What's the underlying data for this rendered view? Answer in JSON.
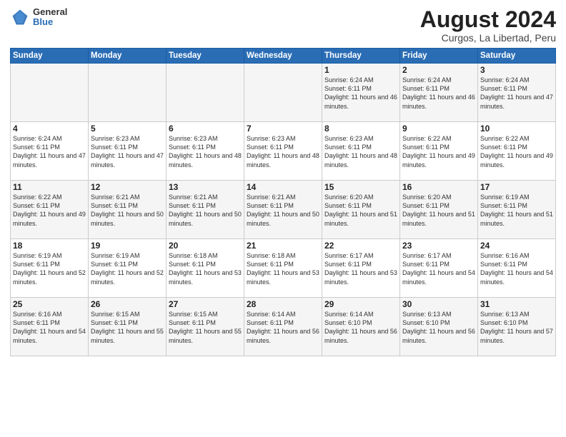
{
  "header": {
    "logo_general": "General",
    "logo_blue": "Blue",
    "title": "August 2024",
    "subtitle": "Curgos, La Libertad, Peru"
  },
  "weekdays": [
    "Sunday",
    "Monday",
    "Tuesday",
    "Wednesday",
    "Thursday",
    "Friday",
    "Saturday"
  ],
  "weeks": [
    [
      {
        "day": "",
        "sunrise": "",
        "sunset": "",
        "daylight": ""
      },
      {
        "day": "",
        "sunrise": "",
        "sunset": "",
        "daylight": ""
      },
      {
        "day": "",
        "sunrise": "",
        "sunset": "",
        "daylight": ""
      },
      {
        "day": "",
        "sunrise": "",
        "sunset": "",
        "daylight": ""
      },
      {
        "day": "1",
        "sunrise": "Sunrise: 6:24 AM",
        "sunset": "Sunset: 6:11 PM",
        "daylight": "Daylight: 11 hours and 46 minutes."
      },
      {
        "day": "2",
        "sunrise": "Sunrise: 6:24 AM",
        "sunset": "Sunset: 6:11 PM",
        "daylight": "Daylight: 11 hours and 46 minutes."
      },
      {
        "day": "3",
        "sunrise": "Sunrise: 6:24 AM",
        "sunset": "Sunset: 6:11 PM",
        "daylight": "Daylight: 11 hours and 47 minutes."
      }
    ],
    [
      {
        "day": "4",
        "sunrise": "Sunrise: 6:24 AM",
        "sunset": "Sunset: 6:11 PM",
        "daylight": "Daylight: 11 hours and 47 minutes."
      },
      {
        "day": "5",
        "sunrise": "Sunrise: 6:23 AM",
        "sunset": "Sunset: 6:11 PM",
        "daylight": "Daylight: 11 hours and 47 minutes."
      },
      {
        "day": "6",
        "sunrise": "Sunrise: 6:23 AM",
        "sunset": "Sunset: 6:11 PM",
        "daylight": "Daylight: 11 hours and 48 minutes."
      },
      {
        "day": "7",
        "sunrise": "Sunrise: 6:23 AM",
        "sunset": "Sunset: 6:11 PM",
        "daylight": "Daylight: 11 hours and 48 minutes."
      },
      {
        "day": "8",
        "sunrise": "Sunrise: 6:23 AM",
        "sunset": "Sunset: 6:11 PM",
        "daylight": "Daylight: 11 hours and 48 minutes."
      },
      {
        "day": "9",
        "sunrise": "Sunrise: 6:22 AM",
        "sunset": "Sunset: 6:11 PM",
        "daylight": "Daylight: 11 hours and 49 minutes."
      },
      {
        "day": "10",
        "sunrise": "Sunrise: 6:22 AM",
        "sunset": "Sunset: 6:11 PM",
        "daylight": "Daylight: 11 hours and 49 minutes."
      }
    ],
    [
      {
        "day": "11",
        "sunrise": "Sunrise: 6:22 AM",
        "sunset": "Sunset: 6:11 PM",
        "daylight": "Daylight: 11 hours and 49 minutes."
      },
      {
        "day": "12",
        "sunrise": "Sunrise: 6:21 AM",
        "sunset": "Sunset: 6:11 PM",
        "daylight": "Daylight: 11 hours and 50 minutes."
      },
      {
        "day": "13",
        "sunrise": "Sunrise: 6:21 AM",
        "sunset": "Sunset: 6:11 PM",
        "daylight": "Daylight: 11 hours and 50 minutes."
      },
      {
        "day": "14",
        "sunrise": "Sunrise: 6:21 AM",
        "sunset": "Sunset: 6:11 PM",
        "daylight": "Daylight: 11 hours and 50 minutes."
      },
      {
        "day": "15",
        "sunrise": "Sunrise: 6:20 AM",
        "sunset": "Sunset: 6:11 PM",
        "daylight": "Daylight: 11 hours and 51 minutes."
      },
      {
        "day": "16",
        "sunrise": "Sunrise: 6:20 AM",
        "sunset": "Sunset: 6:11 PM",
        "daylight": "Daylight: 11 hours and 51 minutes."
      },
      {
        "day": "17",
        "sunrise": "Sunrise: 6:19 AM",
        "sunset": "Sunset: 6:11 PM",
        "daylight": "Daylight: 11 hours and 51 minutes."
      }
    ],
    [
      {
        "day": "18",
        "sunrise": "Sunrise: 6:19 AM",
        "sunset": "Sunset: 6:11 PM",
        "daylight": "Daylight: 11 hours and 52 minutes."
      },
      {
        "day": "19",
        "sunrise": "Sunrise: 6:19 AM",
        "sunset": "Sunset: 6:11 PM",
        "daylight": "Daylight: 11 hours and 52 minutes."
      },
      {
        "day": "20",
        "sunrise": "Sunrise: 6:18 AM",
        "sunset": "Sunset: 6:11 PM",
        "daylight": "Daylight: 11 hours and 53 minutes."
      },
      {
        "day": "21",
        "sunrise": "Sunrise: 6:18 AM",
        "sunset": "Sunset: 6:11 PM",
        "daylight": "Daylight: 11 hours and 53 minutes."
      },
      {
        "day": "22",
        "sunrise": "Sunrise: 6:17 AM",
        "sunset": "Sunset: 6:11 PM",
        "daylight": "Daylight: 11 hours and 53 minutes."
      },
      {
        "day": "23",
        "sunrise": "Sunrise: 6:17 AM",
        "sunset": "Sunset: 6:11 PM",
        "daylight": "Daylight: 11 hours and 54 minutes."
      },
      {
        "day": "24",
        "sunrise": "Sunrise: 6:16 AM",
        "sunset": "Sunset: 6:11 PM",
        "daylight": "Daylight: 11 hours and 54 minutes."
      }
    ],
    [
      {
        "day": "25",
        "sunrise": "Sunrise: 6:16 AM",
        "sunset": "Sunset: 6:11 PM",
        "daylight": "Daylight: 11 hours and 54 minutes."
      },
      {
        "day": "26",
        "sunrise": "Sunrise: 6:15 AM",
        "sunset": "Sunset: 6:11 PM",
        "daylight": "Daylight: 11 hours and 55 minutes."
      },
      {
        "day": "27",
        "sunrise": "Sunrise: 6:15 AM",
        "sunset": "Sunset: 6:11 PM",
        "daylight": "Daylight: 11 hours and 55 minutes."
      },
      {
        "day": "28",
        "sunrise": "Sunrise: 6:14 AM",
        "sunset": "Sunset: 6:11 PM",
        "daylight": "Daylight: 11 hours and 56 minutes."
      },
      {
        "day": "29",
        "sunrise": "Sunrise: 6:14 AM",
        "sunset": "Sunset: 6:10 PM",
        "daylight": "Daylight: 11 hours and 56 minutes."
      },
      {
        "day": "30",
        "sunrise": "Sunrise: 6:13 AM",
        "sunset": "Sunset: 6:10 PM",
        "daylight": "Daylight: 11 hours and 56 minutes."
      },
      {
        "day": "31",
        "sunrise": "Sunrise: 6:13 AM",
        "sunset": "Sunset: 6:10 PM",
        "daylight": "Daylight: 11 hours and 57 minutes."
      }
    ]
  ]
}
